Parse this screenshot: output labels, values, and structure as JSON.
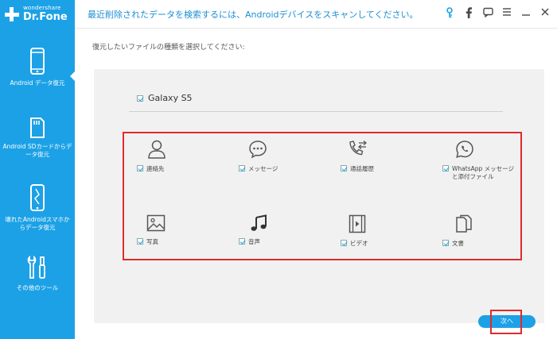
{
  "app": {
    "brand_top": "wondershare",
    "brand_bottom": "Dr.Fone",
    "title_message": "最近削除されたデータを検索するには、Androidデバイスをスキャンしてください。"
  },
  "titlebar_icons": [
    "key-icon",
    "facebook-icon",
    "feedback-icon",
    "menu-icon",
    "minimize-icon",
    "close-icon"
  ],
  "sidebar": {
    "items": [
      {
        "label": "Android データ復元",
        "icon": "phone-icon"
      },
      {
        "label": "Android SDカードからデータ復元",
        "icon": "sd-card-icon"
      },
      {
        "label": "壊れたAndroidスマホからデータ復元",
        "icon": "broken-phone-icon"
      },
      {
        "label": "その他のツール",
        "icon": "tools-icon"
      }
    ]
  },
  "main": {
    "prompt": "復元したいファイルの種類を選択してください:",
    "device_name": "Galaxy S5",
    "file_types": [
      {
        "label": "連絡先",
        "icon": "contacts-icon"
      },
      {
        "label": "メッセージ",
        "icon": "message-icon"
      },
      {
        "label": "通話履歴",
        "icon": "call-history-icon"
      },
      {
        "label": "WhatsApp メッセージと添付ファイル",
        "icon": "whatsapp-icon"
      },
      {
        "label": "写真",
        "icon": "photo-icon"
      },
      {
        "label": "音声",
        "icon": "audio-icon"
      },
      {
        "label": "ビデオ",
        "icon": "video-icon"
      },
      {
        "label": "文書",
        "icon": "document-icon"
      }
    ],
    "next_label": "次へ"
  },
  "colors": {
    "accent": "#1ca1e6",
    "highlight": "#e02b2b",
    "panel": "#f1f1f1"
  }
}
